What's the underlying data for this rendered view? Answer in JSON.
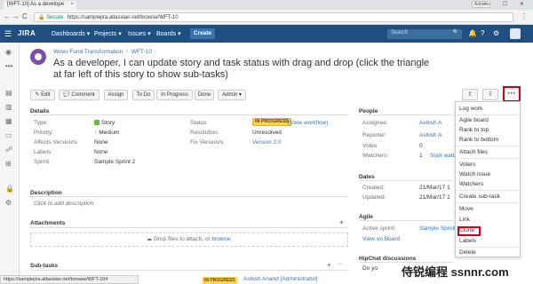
{
  "browser": {
    "tab_title": "[WFT-10] As a develope",
    "tab_close": "×",
    "window_user": "Ashish",
    "window_controls": "— ☐ ✕",
    "back": "←",
    "forward": "→",
    "reload": "C",
    "secure_label": "🔒 Secure",
    "url": "https://samplejira.atlassian.net/browse/WFT-10",
    "menu": "⋮",
    "status_url": "https://samplejira.atlassian.net/browse/WFT-10#"
  },
  "header": {
    "logo": "JIRA",
    "nav": [
      "Dashboards ▾",
      "Projects ▾",
      "Issues ▾",
      "Boards ▾"
    ],
    "create": "Create",
    "search_placeholder": "Search",
    "search_icon": "🔍",
    "help_icon": "?",
    "settings_icon": "⚙",
    "notifications_icon": "🔔"
  },
  "issue": {
    "breadcrumb_project": "Wires Fund Transformation",
    "breadcrumb_sep": "/",
    "breadcrumb_key": "WFT-10",
    "title": "As a developer, I can update story and task status with drag and drop (click the triangle at far left of this story to show sub-tasks)"
  },
  "toolbar": {
    "edit": "✎ Edit",
    "comment": "💬 Comment",
    "assign": "Assign",
    "todo": "To Do",
    "in_progress": "In Progress",
    "done": "Done",
    "admin": "Admin ▾",
    "share_icon": "⇪",
    "export_icon": "⇩",
    "more": "···"
  },
  "details": {
    "heading": "Details",
    "type_label": "Type:",
    "type_value": "Story",
    "priority_label": "Priority:",
    "priority_value": "Medium",
    "affects_label": "Affects Version/s:",
    "affects_value": "None",
    "labels_label": "Labels:",
    "labels_value": "None",
    "sprint_label": "Sprint:",
    "sprint_value": "Sample Sprint 2",
    "status_label": "Status:",
    "status_value": "IN PROGRESS",
    "workflow_link": "(View workflow)",
    "resolution_label": "Resolution:",
    "resolution_value": "Unresolved",
    "fix_label": "Fix Version/s:",
    "fix_value": "Version 2.0"
  },
  "description": {
    "heading": "Description",
    "placeholder": "Click to add description"
  },
  "attachments": {
    "heading": "Attachments",
    "drop_text": "Drop files to attach, or",
    "browse": "browse."
  },
  "subtasks": {
    "heading": "Sub-tasks",
    "assignee": "Ashish Anand [Administrator]",
    "status": "IN PROGRESS"
  },
  "people": {
    "heading": "People",
    "assignee_label": "Assignee:",
    "assignee_value": "Ashish A",
    "reporter_label": "Reporter:",
    "reporter_value": "Ashish A",
    "votes_label": "Votes:",
    "votes_value": "0",
    "watchers_label": "Watchers:",
    "watchers_value": "1",
    "start_watch": "Start watch"
  },
  "dates": {
    "heading": "Dates",
    "created_label": "Created:",
    "created_value": "21/Mar/17 1",
    "updated_label": "Updated:",
    "updated_value": "21/Mar/17 1"
  },
  "agile": {
    "heading": "Agile",
    "active_label": "Active sprint:",
    "active_value": "Sample Sprint",
    "view_board": "View on Board"
  },
  "hipchat": {
    "heading": "HipChat discussions",
    "text": "Do yo"
  },
  "more_menu": {
    "items": [
      "Log work",
      "Agile board",
      "Rank to top",
      "Rank to bottom",
      "Attach files",
      "Voters",
      "Watch issue",
      "Watchers",
      "Create sub-task",
      "Move",
      "Link",
      "Clone",
      "Labels",
      "Delete"
    ]
  },
  "watermark": "侍锐编程 ssnnr.com"
}
